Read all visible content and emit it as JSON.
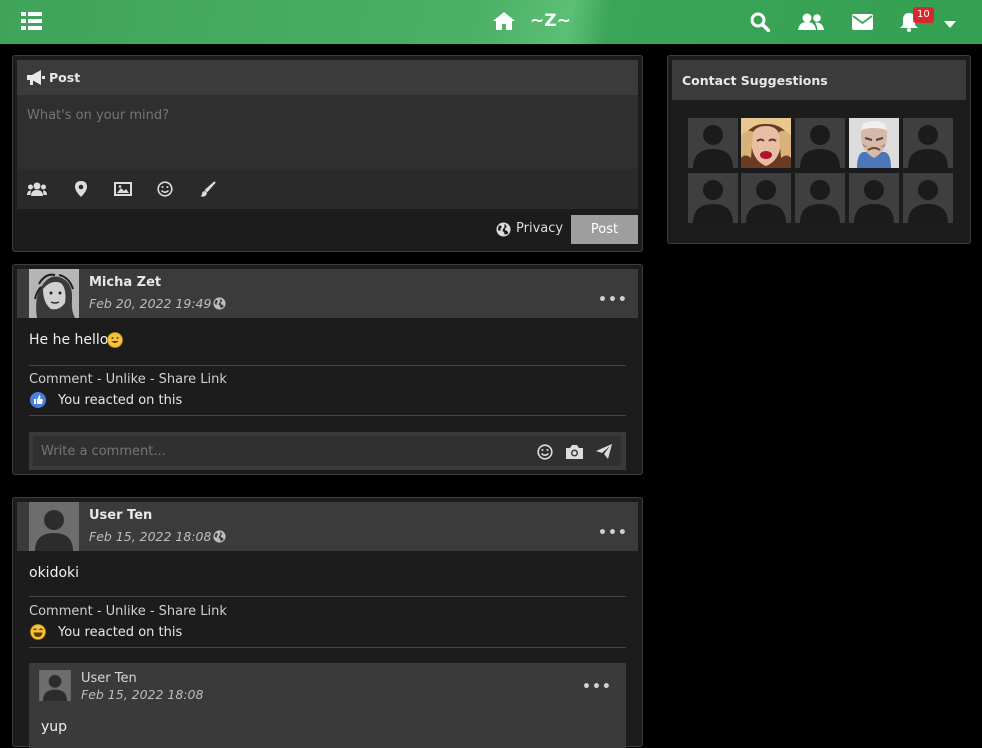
{
  "topbar": {
    "brand": "~Z~",
    "notification_count": "10"
  },
  "composer": {
    "header": "Post",
    "placeholder": "What's on your mind?",
    "privacy_label": "Privacy",
    "post_label": "Post"
  },
  "posts": [
    {
      "author": "Micha Zet",
      "date": "Feb 20, 2022 19:49 -",
      "body": "He he hello",
      "actions": "Comment - Unlike - Share Link",
      "reaction": "You reacted on this",
      "comment_placeholder": "Write a comment..."
    },
    {
      "author": "User Ten",
      "date": "Feb 15, 2022 18:08 -",
      "body": "okidoki",
      "actions": "Comment - Unlike - Share Link",
      "reaction": "You reacted on this",
      "comments": [
        {
          "author": "User Ten",
          "date": "Feb 15, 2022 18:08",
          "body": "yup"
        }
      ]
    }
  ],
  "sidebar": {
    "title": "Contact Suggestions"
  },
  "colors": {
    "topbar": "#3fa45a",
    "badge": "#d9272e",
    "panel": "#1c1c1c",
    "panel_head": "#3b3b3b"
  }
}
